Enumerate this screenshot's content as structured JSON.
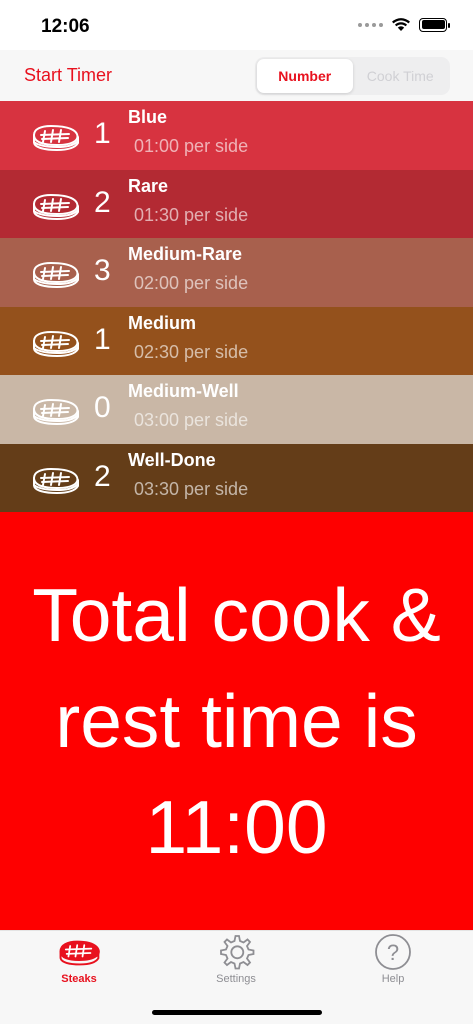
{
  "status": {
    "time": "12:06"
  },
  "nav": {
    "start_timer": "Start Timer",
    "segments": [
      {
        "label": "Number",
        "selected": true
      },
      {
        "label": "Cook Time",
        "selected": false
      }
    ]
  },
  "steaks": [
    {
      "name": "Blue",
      "count": "1",
      "time": "01:00 per side",
      "color": "#d73340"
    },
    {
      "name": "Rare",
      "count": "2",
      "time": "01:30 per side",
      "color": "#b32a33"
    },
    {
      "name": "Medium-Rare",
      "count": "3",
      "time": "02:00 per side",
      "color": "#a8604d"
    },
    {
      "name": "Medium",
      "count": "1",
      "time": "02:30 per side",
      "color": "#94511c"
    },
    {
      "name": "Medium-Well",
      "count": "0",
      "time": "03:00 per side",
      "color": "#c9b7a6"
    },
    {
      "name": "Well-Done",
      "count": "2",
      "time": "03:30 per side",
      "color": "#643d18"
    }
  ],
  "total": {
    "line1": "Total cook &",
    "line2": "rest time is",
    "line3": "11:00",
    "color": "#fe0000"
  },
  "tabs": [
    {
      "label": "Steaks",
      "icon": "steak-icon",
      "active": true
    },
    {
      "label": "Settings",
      "icon": "gear-icon",
      "active": false
    },
    {
      "label": "Help",
      "icon": "question-circle-icon",
      "active": false
    }
  ],
  "colors": {
    "accent": "#e8111e"
  }
}
